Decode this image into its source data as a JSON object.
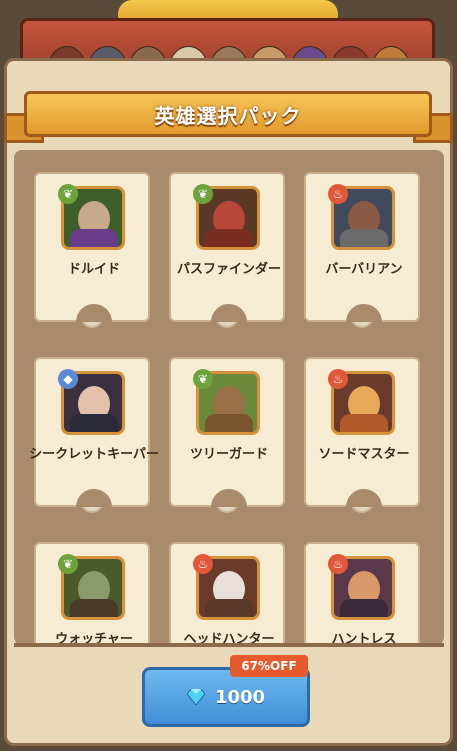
{
  "header": {
    "title": "英雄選択パック"
  },
  "heroes": [
    {
      "name": "ドルイド",
      "class_icon": "leaf-icon",
      "face": "#c9a98c",
      "body": "#6a3d8a",
      "bg": "#3e5f2a",
      "icon_color": "#6ea23c"
    },
    {
      "name": "パスファインダー",
      "class_icon": "leaf-icon",
      "face": "#b9473a",
      "body": "#7a2e22",
      "bg": "#5a3a26",
      "icon_color": "#6ea23c"
    },
    {
      "name": "バーバリアン",
      "class_icon": "flame-icon",
      "face": "#8a5a44",
      "body": "#6b6b6b",
      "bg": "#404a5a",
      "icon_color": "#e0573a"
    },
    {
      "name": "シークレットキーパー",
      "class_icon": "shield-icon",
      "face": "#e2c2a8",
      "body": "#2a2a3a",
      "bg": "#3a3040",
      "icon_color": "#5a8ad6"
    },
    {
      "name": "ツリーガード",
      "class_icon": "leaf-icon",
      "face": "#9a7048",
      "body": "#7a5530",
      "bg": "#6a8a3a",
      "icon_color": "#6ea23c"
    },
    {
      "name": "ソードマスター",
      "class_icon": "flame-icon",
      "face": "#e8a85a",
      "body": "#b05a2a",
      "bg": "#6a3a2a",
      "icon_color": "#e0573a"
    },
    {
      "name": "ウォッチャー",
      "class_icon": "leaf-icon",
      "face": "#8a9a6a",
      "body": "#4a3a2a",
      "bg": "#4a5a2a",
      "icon_color": "#6ea23c"
    },
    {
      "name": "ヘッドハンター",
      "class_icon": "flame-icon",
      "face": "#e8e0d8",
      "body": "#5a3a2a",
      "bg": "#6a3a2a",
      "icon_color": "#e0573a"
    },
    {
      "name": "ハントレス",
      "class_icon": "flame-icon",
      "face": "#d8986a",
      "body": "#3a2a3a",
      "bg": "#5a3a4a",
      "icon_color": "#e0573a"
    }
  ],
  "purchase": {
    "price": "1000",
    "currency_icon": "gem-icon",
    "discount": "67%OFF"
  }
}
